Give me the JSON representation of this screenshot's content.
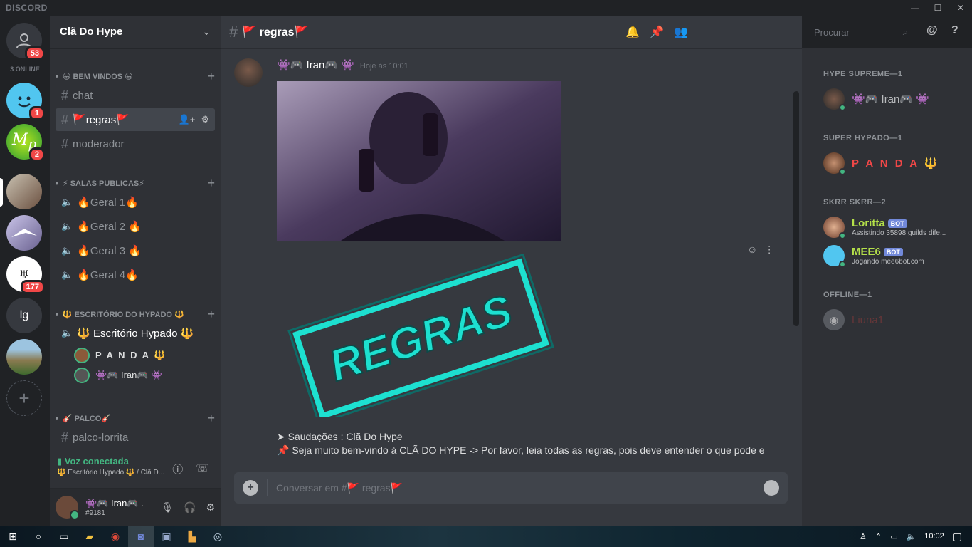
{
  "app": {
    "brand": "DISCORD"
  },
  "window": {
    "min": "—",
    "max": "☐",
    "close": "✕"
  },
  "guilds": {
    "online_label": "3 ONLINE",
    "dm_badge": "53",
    "items": [
      {
        "name": "smile-server",
        "badge": "1"
      },
      {
        "name": "mp-server",
        "badge": "2"
      },
      {
        "name": "photo-server",
        "badge": ""
      },
      {
        "name": "bird-server",
        "badge": ""
      },
      {
        "name": "tribe-server",
        "badge": "177"
      },
      {
        "name": "lg-server",
        "label": "lg",
        "badge": ""
      },
      {
        "name": "mountain-server",
        "badge": ""
      }
    ],
    "add_label": "+"
  },
  "server": {
    "name": "Clã Do Hype",
    "categories": [
      {
        "label": "😀 BEM VINDOS 😀"
      },
      {
        "label": "⚡ SALAS PUBLICAS⚡"
      },
      {
        "label": "🔱 ESCRITÓRIO DO HYPADO 🔱"
      },
      {
        "label": "🎸 PALCO🎸"
      }
    ],
    "channels": {
      "chat": "chat",
      "regras": "🚩regras🚩",
      "moderador": "moderador",
      "geral1": "🔥Geral 1🔥",
      "geral2": "🔥Geral 2 🔥",
      "geral3": "🔥Geral 3 🔥",
      "geral4": "🔥Geral 4🔥",
      "escritorio": "🔱 Escritório Hypado 🔱",
      "palco": "palco-lorrita"
    },
    "voice_users": [
      "P A N D A 🔱",
      "👾🎮 Iran🎮 👾"
    ]
  },
  "voice": {
    "status": "Voz conectada",
    "location": "🔱 Escritório Hypado 🔱 / Clã D..."
  },
  "user": {
    "name": "👾🎮 Iran🎮 .",
    "tag": "#9181"
  },
  "chat": {
    "channel_title": "🚩 regras🚩",
    "search_placeholder": "Procurar",
    "author": "👾🎮 Iran🎮 👾",
    "timestamp": "Hoje às 10:01",
    "image_text": "REGRAS",
    "line1": "➤ Saudações : Clã Do Hype",
    "line2": "📌 Seja muito bem-vindo à CLÃ DO HYPE -> Por favor, leia todas as regras, pois deve entender o que pode e",
    "input_placeholder": "Conversar em #🚩 regras🚩"
  },
  "members": {
    "groups": [
      {
        "header": "HYPE SUPREME—1",
        "members": [
          {
            "name": "👾🎮 Iran🎮 👾",
            "color": "#b9bbbe"
          }
        ]
      },
      {
        "header": "SUPER HYPADO—1",
        "members": [
          {
            "name": "P A N D A 🔱",
            "color": "#f04747"
          }
        ]
      },
      {
        "header": "SKRR SKRR—2",
        "members": [
          {
            "name": "Loritta",
            "color": "#b4e04a",
            "bot": "BOT",
            "activity": "Assistindo 35898 guilds dife..."
          },
          {
            "name": "MEE6",
            "color": "#b4e04a",
            "bot": "BOT",
            "activity": "Jogando mee6bot.com"
          }
        ]
      },
      {
        "header": "OFFLINE—1",
        "members": [
          {
            "name": "Liuna1",
            "color": "#5d3a3a"
          }
        ]
      }
    ]
  },
  "taskbar": {
    "clock": "10:02"
  },
  "colors": {
    "online": "#43b581",
    "badge": "#f04747",
    "blurple": "#7289da"
  }
}
